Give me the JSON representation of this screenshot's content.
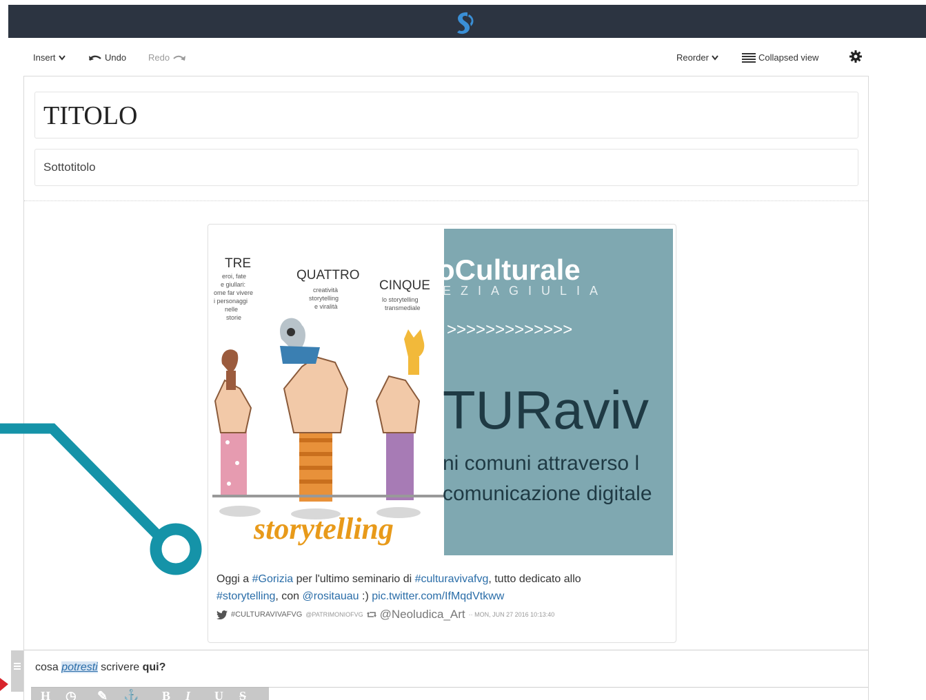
{
  "toolbar": {
    "insert_label": "Insert",
    "undo_label": "Undo",
    "redo_label": "Redo",
    "reorder_label": "Reorder",
    "collapsed_view_label": "Collapsed view"
  },
  "document": {
    "title": "TITOLO",
    "subtitle": "Sottotitolo"
  },
  "embed": {
    "image_words": {
      "tre": "TRE",
      "tre_caption": "eroi, fate e giullari: ome far vivere i personaggi nelle storie",
      "quattro": "QUATTRO",
      "quattro_caption": "creatività storytelling e viralità",
      "cinque": "CINQUE",
      "cinque_caption": "lo storytelling transmediale",
      "storytelling": "storytelling",
      "brand": "oCulturale",
      "region": "EZIAGIULIA",
      "arrows": ">>>>>>>>>>>>>",
      "big_word": "TURaviv",
      "line1": "ni comuni attraverso l",
      "line2": "comunicazione digitale"
    },
    "text_prefix": "Oggi a ",
    "hashtag_gorizia": "#Gorizia",
    "text_mid1": " per l'ultimo seminario di ",
    "hashtag_cultura": "#culturavivafvg",
    "text_mid2": ", tutto dedicato allo",
    "hashtag_story": "#storytelling",
    "text_mid3": ", con ",
    "mention": "@rositauau",
    "text_mid4": " :) ",
    "pic_link": "pic.twitter.com/IfMqdVtkww",
    "meta_hashtag": "#CULTURAVIVAFVG",
    "meta_account": "@PATRIMONIOFVG",
    "meta_user": "@Neoludica_Art",
    "meta_date": "·· MON, JUN 27 2016 10:13:40"
  },
  "paragraph": {
    "part1": "cosa ",
    "italic": "potresti",
    "part2": " scrivere ",
    "bold": "qui?"
  },
  "format_bar": [
    "H",
    "◷",
    "✎",
    "⚓",
    "B",
    "I",
    "U",
    "S"
  ],
  "colors": {
    "topbar": "#2c3441",
    "logo": "#3a8fd6",
    "annotation": "#1593a8",
    "image_teal": "#7fa8b1",
    "storytelling_orange": "#e89a1a"
  }
}
